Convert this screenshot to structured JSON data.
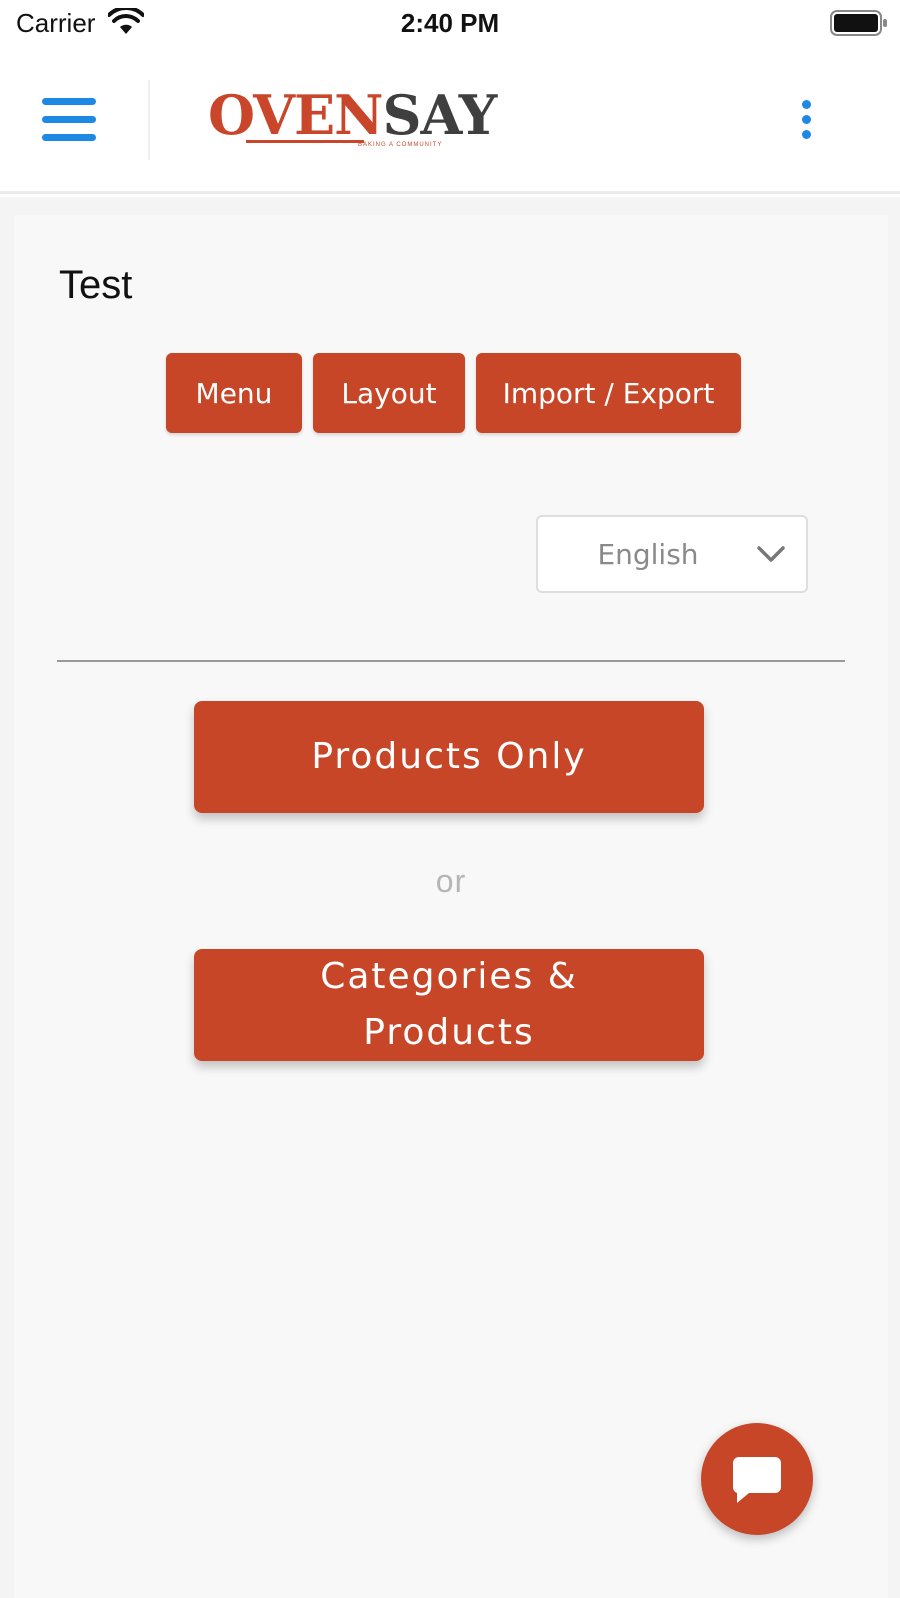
{
  "status_bar": {
    "carrier": "Carrier",
    "time": "2:40 PM",
    "wifi_icon": "wifi-icon",
    "battery_icon": "battery-icon"
  },
  "navbar": {
    "menu_icon": "hamburger-menu-icon",
    "logo": {
      "part_o": "O",
      "part_ven": "VEN",
      "part_say": "SAY",
      "tagline": "BAKING A COMMUNITY"
    },
    "more_icon": "more-vertical-icon"
  },
  "main": {
    "title": "Test",
    "tabs": [
      {
        "label": "Menu"
      },
      {
        "label": "Layout"
      },
      {
        "label": "Import / Export"
      }
    ],
    "language_select": {
      "value": "English",
      "icon": "chevron-down-icon"
    },
    "products_only_label": "Products Only",
    "or_label": "or",
    "categories_products_label": "Categories & Products"
  },
  "chat_button": {
    "icon": "chat-bubble-icon"
  },
  "colors": {
    "accent": "#c84628",
    "nav_blue": "#1e88e5",
    "background": "#f8f8f8"
  }
}
